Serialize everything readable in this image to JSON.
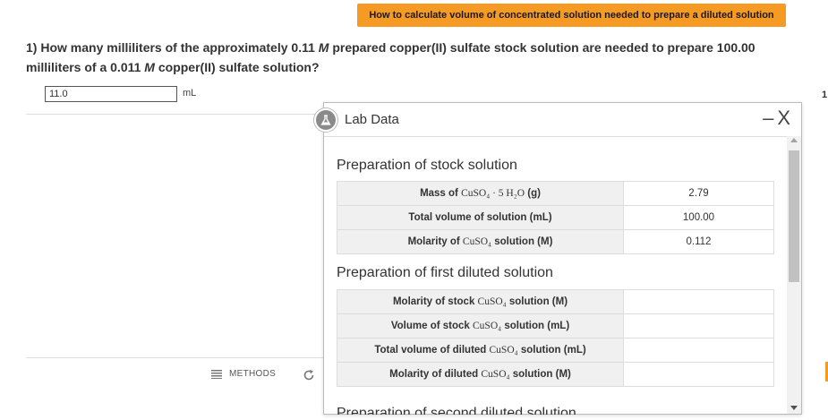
{
  "hint_button": "How to calculate volume of concentrated solution needed to prepare a diluted solution",
  "question": {
    "part1": "1) How many milliliters of the approximately 0.11 ",
    "m1": "M",
    "part2": " prepared copper(II) sulfate stock solution are needed to prepare 100.00 milliliters of a 0.011 ",
    "m2": "M",
    "part3": " copper(II) sulfate solution?"
  },
  "answer": {
    "value": "11.0",
    "unit": "mL"
  },
  "edge_number": "1",
  "footer": {
    "methods_label": "METHODS",
    "methods_icon": "list-icon",
    "reset_icon": "reset-icon"
  },
  "lab_data": {
    "title": "Lab Data",
    "minimize": "–",
    "close": "X",
    "icon": "flask-icon",
    "sections": [
      {
        "title": "Preparation of stock solution",
        "rows": [
          {
            "label_pre": "Mass of ",
            "formula": "CuSO₄ · 5 H₂O",
            "label_post": " (g)",
            "value": "2.79"
          },
          {
            "label_pre": "Total volume of solution (mL)",
            "formula": "",
            "label_post": "",
            "value": "100.00"
          },
          {
            "label_pre": "Molarity of ",
            "formula": "CuSO₄",
            "label_post": " solution (M)",
            "value": "0.112"
          }
        ]
      },
      {
        "title": "Preparation of first diluted solution",
        "rows": [
          {
            "label_pre": "Molarity of stock ",
            "formula": "CuSO₄",
            "label_post": " solution (M)",
            "value": ""
          },
          {
            "label_pre": "Volume of stock ",
            "formula": "CuSO₄",
            "label_post": " solution (mL)",
            "value": ""
          },
          {
            "label_pre": "Total volume of diluted ",
            "formula": "CuSO₄",
            "label_post": " solution (mL)",
            "value": ""
          },
          {
            "label_pre": "Molarity of diluted ",
            "formula": "CuSO₄",
            "label_post": " solution (M)",
            "value": ""
          }
        ]
      }
    ],
    "next_section_partial": "Preparation of second diluted solution"
  },
  "colors": {
    "accent": "#f59a22",
    "header_bg": "#f0f0f0"
  }
}
